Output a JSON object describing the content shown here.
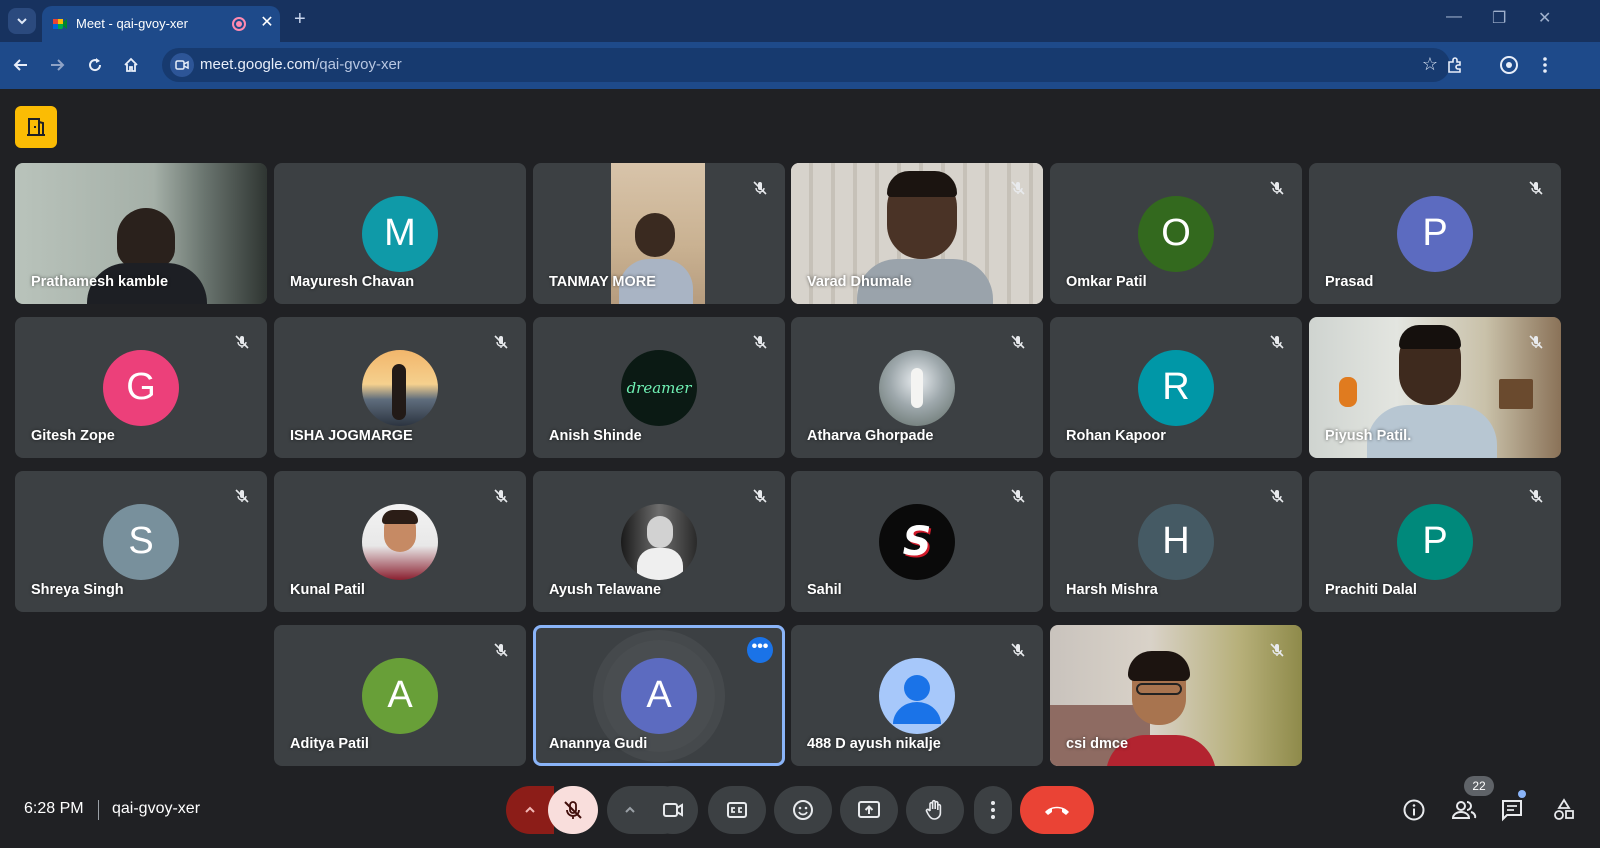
{
  "browser": {
    "tab_title": "Meet - qai-gvoy-xer",
    "url_host": "meet.google.com",
    "url_path": "/qai-gvoy-xer",
    "close_glyph": "✕",
    "new_tab_glyph": "+",
    "minimize_glyph": "—",
    "restore_glyph": "❐",
    "win_close_glyph": "✕"
  },
  "participants": [
    {
      "name": "Prathamesh kamble"
    },
    {
      "name": "Mayuresh Chavan",
      "initial": "M",
      "color": "#0f9aa8"
    },
    {
      "name": "TANMAY MORE"
    },
    {
      "name": "Varad Dhumale"
    },
    {
      "name": "Omkar Patil",
      "initial": "O",
      "color": "#33691e"
    },
    {
      "name": "Prasad",
      "initial": "P",
      "color": "#5c6bc0"
    },
    {
      "name": "Gitesh Zope",
      "initial": "G",
      "color": "#ec407a"
    },
    {
      "name": "ISHA JOGMARGE"
    },
    {
      "name": "Anish Shinde",
      "avatar_text": "dreamer"
    },
    {
      "name": "Atharva Ghorpade"
    },
    {
      "name": "Rohan Kapoor",
      "initial": "R",
      "color": "#0097a7"
    },
    {
      "name": "Piyush Patil."
    },
    {
      "name": "Shreya Singh",
      "initial": "S",
      "color": "#78909c"
    },
    {
      "name": "Kunal Patil"
    },
    {
      "name": "Ayush Telawane"
    },
    {
      "name": "Sahil",
      "avatar_text": "S"
    },
    {
      "name": "Harsh Mishra",
      "initial": "H",
      "color": "#455a64"
    },
    {
      "name": "Prachiti Dalal",
      "initial": "P",
      "color": "#00897b"
    },
    {
      "name": "Aditya Patil",
      "initial": "A",
      "color": "#689f38"
    },
    {
      "name": "Anannya Gudi",
      "initial": "A",
      "color": "#5c6bc0"
    },
    {
      "name": "488 D ayush nikalje"
    },
    {
      "name": "csi dmce"
    }
  ],
  "meeting": {
    "time": "6:28 PM",
    "code": "qai-gvoy-xer",
    "participant_count": "22"
  },
  "colors": {
    "end_call": "#ea4335",
    "mic_off_bg": "#f9dedc",
    "mic_arrow_bg": "#8c1d18",
    "accent": "#8ab4f8"
  }
}
